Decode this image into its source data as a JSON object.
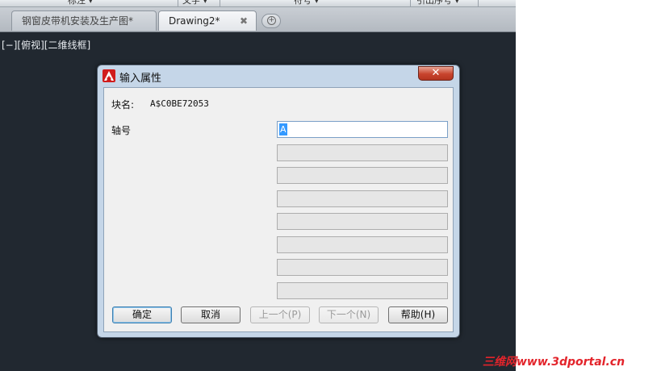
{
  "ribbon": {
    "groups": [
      "标注 ▾",
      "文字 ▾",
      "符号 ▾",
      "引出序号 ▾"
    ]
  },
  "tabs": [
    {
      "label": "钢窗皮带机安装及生产图*",
      "active": false
    },
    {
      "label": "Drawing2*",
      "active": true,
      "close": "✖"
    }
  ],
  "viewport": {
    "label": "[−][俯视][二维线框]"
  },
  "dialog": {
    "title": "输入属性",
    "close_glyph": "✕",
    "block_name_label": "块名:",
    "block_name_value": "A$C0BE72053",
    "attribute_label": "轴号",
    "first_value": "A",
    "buttons": {
      "ok": "确定",
      "cancel": "取消",
      "prev": "上一个(P)",
      "next": "下一个(N)",
      "help": "帮助(H)"
    }
  },
  "watermark": "三维网www.3dportal.cn",
  "colors": {
    "viewport_bg": "#212830",
    "dialog_frame": "#c5d6e8",
    "close_button": "#c8442d",
    "app_icon": "#d01c1c",
    "watermark": "#e3242b"
  }
}
